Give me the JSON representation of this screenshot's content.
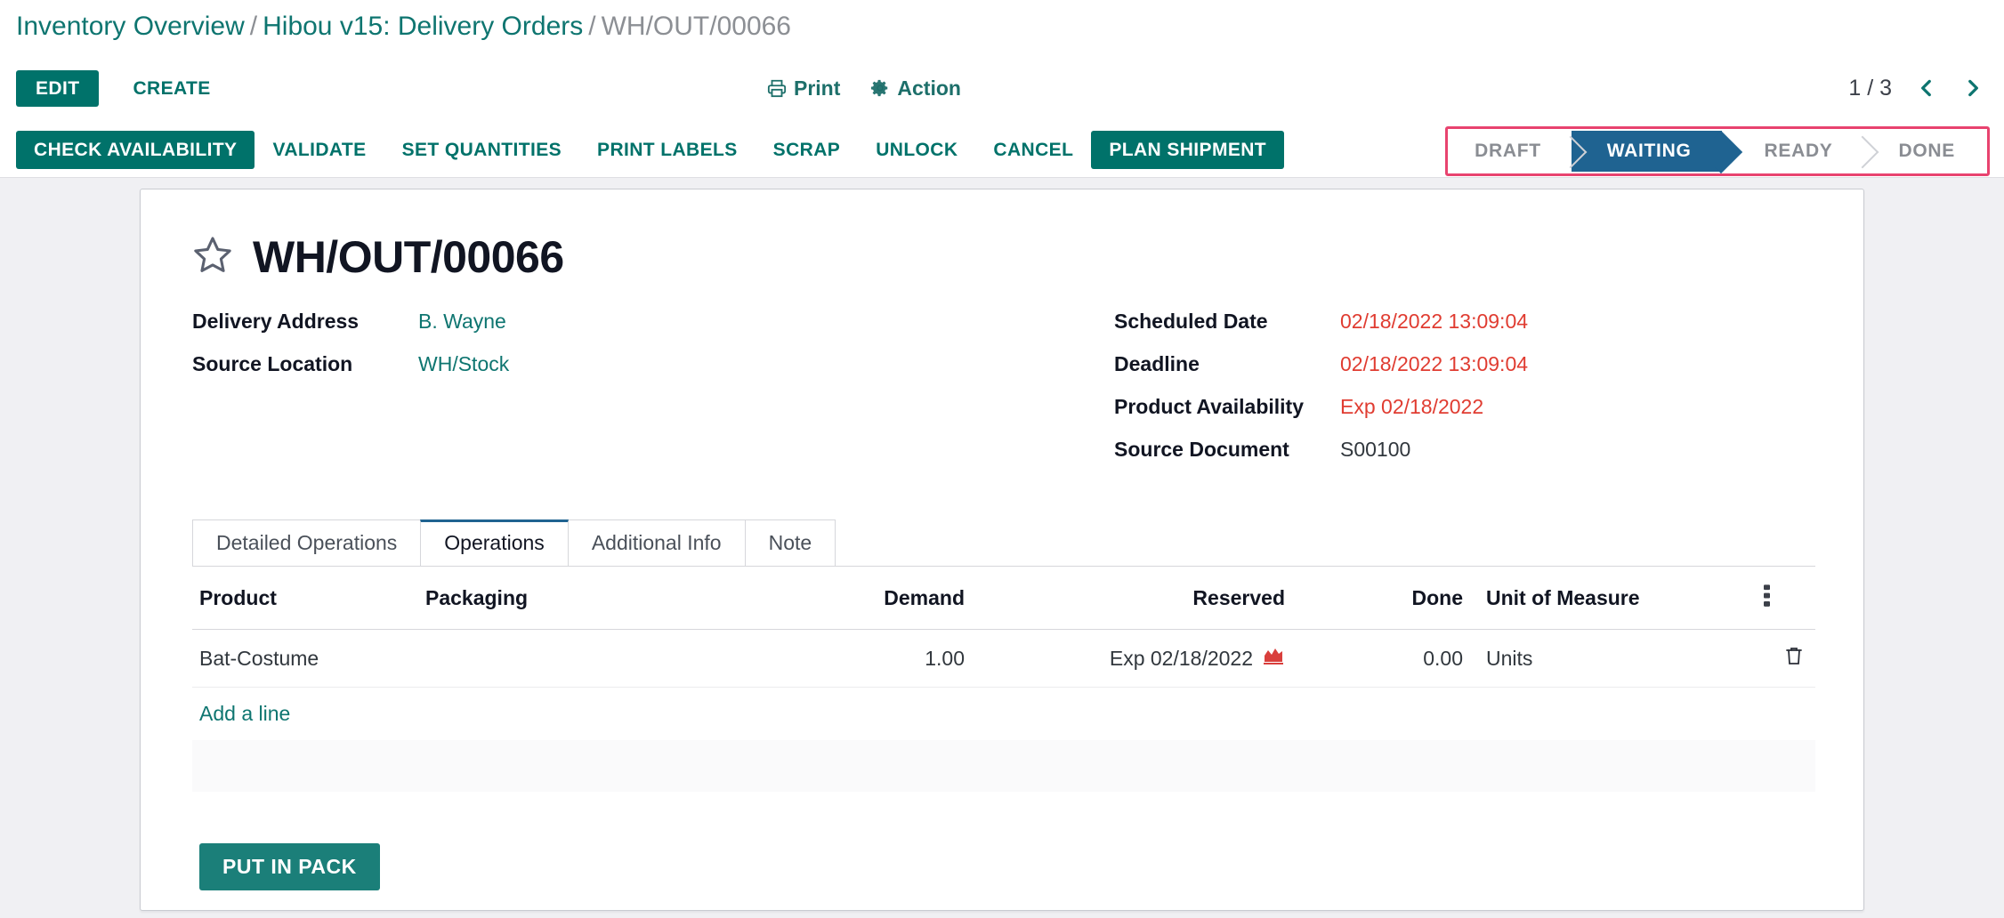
{
  "breadcrumb": {
    "root": "Inventory Overview",
    "parent": "Hibou v15: Delivery Orders",
    "current": "WH/OUT/00066",
    "separator": "/"
  },
  "control_panel": {
    "edit_label": "EDIT",
    "create_label": "CREATE",
    "print_label": "Print",
    "action_label": "Action",
    "pager_text": "1 / 3",
    "prev_icon": "chevron-left-icon",
    "next_icon": "chevron-right-icon",
    "print_icon": "printer-icon",
    "action_icon": "gear-icon"
  },
  "action_buttons": [
    {
      "label": "CHECK AVAILABILITY",
      "primary": true
    },
    {
      "label": "VALIDATE",
      "primary": false
    },
    {
      "label": "SET QUANTITIES",
      "primary": false
    },
    {
      "label": "PRINT LABELS",
      "primary": false
    },
    {
      "label": "SCRAP",
      "primary": false
    },
    {
      "label": "UNLOCK",
      "primary": false
    },
    {
      "label": "CANCEL",
      "primary": false
    },
    {
      "label": "PLAN SHIPMENT",
      "primary": true
    }
  ],
  "statusbar": {
    "stages": [
      "DRAFT",
      "WAITING",
      "READY",
      "DONE"
    ],
    "active": "WAITING",
    "highlight_color": "#e8436f",
    "active_color": "#1f6391"
  },
  "record": {
    "favorite_icon": "star-outline-icon",
    "title": "WH/OUT/00066"
  },
  "fields_left": [
    {
      "label": "Delivery Address",
      "value": "B. Wayne",
      "style": "link"
    },
    {
      "label": "Source Location",
      "value": "WH/Stock",
      "style": "link"
    }
  ],
  "fields_right": [
    {
      "label": "Scheduled Date",
      "value": "02/18/2022 13:09:04",
      "style": "danger"
    },
    {
      "label": "Deadline",
      "value": "02/18/2022 13:09:04",
      "style": "danger"
    },
    {
      "label": "Product Availability",
      "value": "Exp 02/18/2022",
      "style": "danger"
    },
    {
      "label": "Source Document",
      "value": "S00100",
      "style": "plain"
    }
  ],
  "notebook": {
    "tabs": [
      {
        "label": "Detailed Operations",
        "active": false
      },
      {
        "label": "Operations",
        "active": true
      },
      {
        "label": "Additional Info",
        "active": false
      },
      {
        "label": "Note",
        "active": false
      }
    ]
  },
  "table": {
    "columns": [
      "Product",
      "Packaging",
      "Demand",
      "Reserved",
      "Done",
      "Unit of Measure"
    ],
    "optional_columns_icon": "vertical-dots-icon",
    "rows": [
      {
        "product": "Bat-Costume",
        "packaging": "",
        "demand": "1.00",
        "reserved": "Exp 02/18/2022",
        "reserved_icon": "area-chart-icon",
        "done": "0.00",
        "uom": "Units",
        "delete_icon": "trash-icon"
      }
    ],
    "add_line_label": "Add a line"
  },
  "footer": {
    "put_in_pack_label": "PUT IN PACK"
  },
  "colors": {
    "teal": "#00726a",
    "link_teal": "#0e7570",
    "danger_red": "#e03c31",
    "status_blue": "#1f6391",
    "highlight_pink": "#e8436f"
  }
}
